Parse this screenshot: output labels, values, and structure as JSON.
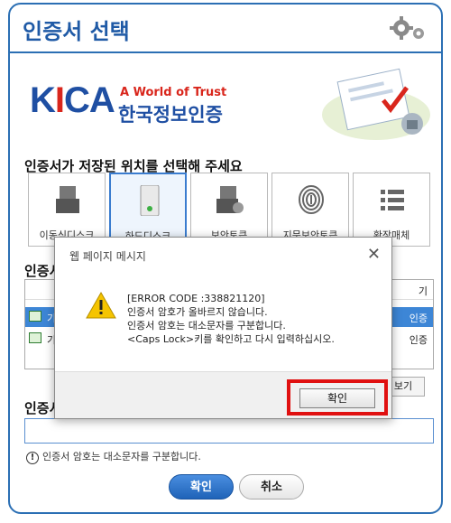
{
  "window": {
    "title": "인증서 선택"
  },
  "banner": {
    "logo_k": "K",
    "logo_i": "I",
    "logo_ca": "CA",
    "slogan": "A World of Trust",
    "org_name": "한국정보인증"
  },
  "storage": {
    "label": "인증서가 저장된 위치를 선택해 주세요",
    "items": [
      {
        "label": "이동식디스크",
        "icon": "usb-drive-icon"
      },
      {
        "label": "하드디스크",
        "icon": "hard-disk-icon"
      },
      {
        "label": "보안토큰",
        "icon": "security-token-icon"
      },
      {
        "label": "지문보안토큰",
        "icon": "fingerprint-icon"
      },
      {
        "label": "확장매체",
        "icon": "list-icon"
      }
    ]
  },
  "cert_list": {
    "label": "인증서",
    "header_right": "기",
    "rows": [
      {
        "name": "기",
        "issuer": "인증"
      },
      {
        "name": "기",
        "issuer": "인증"
      }
    ],
    "detail_button": "보기"
  },
  "password": {
    "label": "인증서",
    "hint": "인증서 암호는 대소문자를 구분합니다."
  },
  "buttons": {
    "ok": "확인",
    "cancel": "취소"
  },
  "dialog": {
    "title": "웹 페이지 메시지",
    "close": "✕",
    "messages": [
      "[ERROR CODE :338821120]",
      "인증서 암호가 올바르지 않습니다.",
      "인증서 암호는 대소문자를 구분합니다.",
      "<Caps Lock>키를 확인하고 다시 입력하십시오."
    ],
    "ok_button": "확인"
  },
  "colors": {
    "accent": "#2b6fb4",
    "highlight": "#e01010",
    "brand_red": "#d9261c"
  }
}
